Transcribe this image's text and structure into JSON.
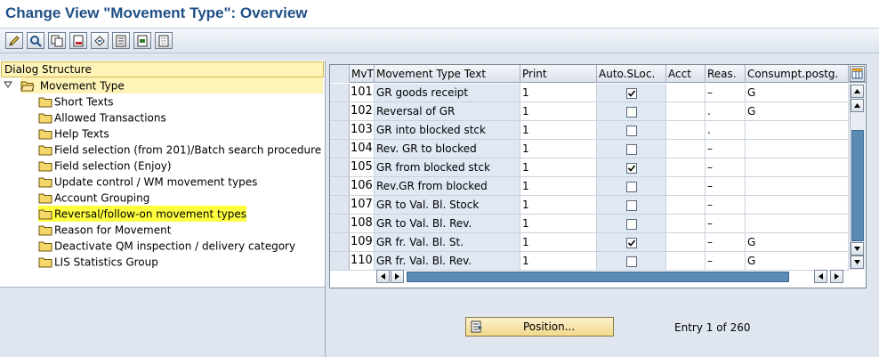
{
  "window": {
    "title": "Change View \"Movement Type\": Overview"
  },
  "toolbar": {
    "buttons": [
      {
        "icon": "pencil-edit-icon"
      },
      {
        "icon": "display-change-icon"
      },
      {
        "icon": "copy-icon"
      },
      {
        "icon": "delete-icon"
      },
      {
        "icon": "undo-icon"
      },
      {
        "icon": "select-all-icon"
      },
      {
        "icon": "select-block-icon"
      },
      {
        "icon": "deselect-all-icon"
      }
    ]
  },
  "dialog_structure": {
    "header": "Dialog Structure",
    "root": {
      "label": "Movement Type",
      "expanded": true,
      "selected": true
    },
    "items": [
      {
        "label": "Short Texts"
      },
      {
        "label": "Allowed Transactions"
      },
      {
        "label": "Help Texts"
      },
      {
        "label": "Field selection (from 201)/Batch search procedure"
      },
      {
        "label": "Field selection (Enjoy)"
      },
      {
        "label": "Update control / WM movement types"
      },
      {
        "label": "Account Grouping"
      },
      {
        "label": "Reversal/follow-on movement types",
        "highlighted": true
      },
      {
        "label": "Reason for Movement"
      },
      {
        "label": "Deactivate QM inspection / delivery category"
      },
      {
        "label": "LIS Statistics Group"
      }
    ]
  },
  "table": {
    "columns": [
      "MvT",
      "Movement Type Text",
      "Print",
      "Auto.SLoc.",
      "Acct",
      "Reas.",
      "Consumpt.postg."
    ],
    "rows": [
      {
        "mvt": "101",
        "text": "GR goods receipt",
        "print": "1",
        "auto": true,
        "acct": "",
        "reas": "–",
        "cons": "G"
      },
      {
        "mvt": "102",
        "text": "Reversal of GR",
        "print": "1",
        "auto": false,
        "acct": "",
        "reas": ".",
        "cons": "G"
      },
      {
        "mvt": "103",
        "text": "GR into blocked stck",
        "print": "1",
        "auto": false,
        "acct": "",
        "reas": ".",
        "cons": ""
      },
      {
        "mvt": "104",
        "text": "Rev. GR to blocked",
        "print": "1",
        "auto": false,
        "acct": "",
        "reas": "–",
        "cons": ""
      },
      {
        "mvt": "105",
        "text": "GR from blocked stck",
        "print": "1",
        "auto": true,
        "acct": "",
        "reas": "–",
        "cons": ""
      },
      {
        "mvt": "106",
        "text": "Rev.GR from blocked",
        "print": "1",
        "auto": false,
        "acct": "",
        "reas": "–",
        "cons": ""
      },
      {
        "mvt": "107",
        "text": "GR to Val. Bl. Stock",
        "print": "1",
        "auto": false,
        "acct": "",
        "reas": "–",
        "cons": ""
      },
      {
        "mvt": "108",
        "text": "GR to Val. Bl. Rev.",
        "print": "1",
        "auto": false,
        "acct": "",
        "reas": "–",
        "cons": ""
      },
      {
        "mvt": "109",
        "text": "GR fr. Val. Bl. St.",
        "print": "1",
        "auto": true,
        "acct": "",
        "reas": "–",
        "cons": "G"
      },
      {
        "mvt": "110",
        "text": "GR fr. Val. Bl. Rev.",
        "print": "1",
        "auto": false,
        "acct": "",
        "reas": "–",
        "cons": "G"
      }
    ]
  },
  "position_button": {
    "label": "Position..."
  },
  "entry_status": "Entry 1 of 260",
  "colors": {
    "title": "#1f4f86",
    "highlight": "#ffff40",
    "scroll_thumb": "#5a8bb5"
  }
}
